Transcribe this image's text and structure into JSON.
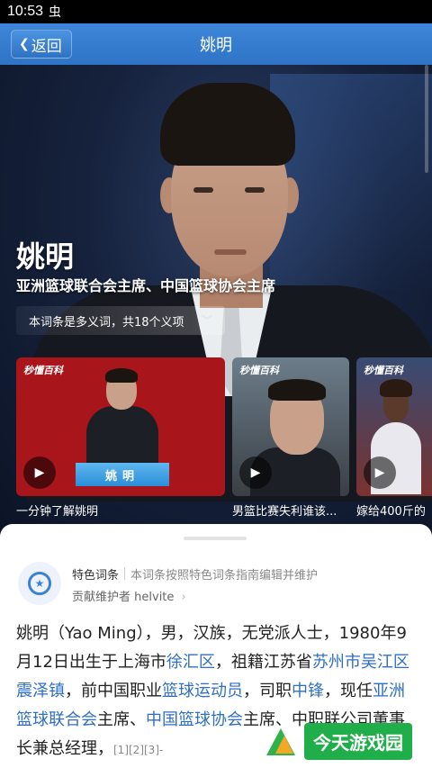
{
  "status_bar": {
    "time": "10:53",
    "bug_icon": "虫"
  },
  "nav": {
    "back_label": "返回",
    "title": "姚明"
  },
  "hero": {
    "name": "姚明",
    "subtitle": "亚洲篮球联合会主席、中国篮球协会主席",
    "polysemy_label": "本词条是多义词，共18个义项"
  },
  "videos": [
    {
      "logo": "秒懂百科",
      "ribbon": "姚明",
      "caption": "一分钟了解姚明"
    },
    {
      "logo": "秒懂百科",
      "caption": "男篮比赛失利谁该..."
    },
    {
      "logo": "秒懂百科",
      "caption": "嫁给400斤的"
    }
  ],
  "feature": {
    "label": "特色词条",
    "desc": "本词条按照特色词条指南编辑并维护",
    "contributor_prefix": "贡献维护者",
    "contributor_name": "helvite"
  },
  "body": {
    "t1": "姚明（Yao Ming），男，汉族，无党派人士，1980年9月12日出生于上海市",
    "l1": "徐汇区",
    "t2": "，祖籍江苏省",
    "l2": "苏州市吴江区震泽镇",
    "t3": "，前中国职业",
    "l3": "篮球运动员",
    "t4": "，司职",
    "l4": "中锋",
    "t5": "，现任",
    "l5": "亚洲篮球联合会",
    "t6": "主席、",
    "l6": "中国篮球协会",
    "t7": "主席、中职联公司董事长兼总经理，",
    "refs": "[1][2][3]-"
  },
  "watermark": {
    "text": "今天游戏园"
  },
  "colors": {
    "nav_bg": "#3a7fd0",
    "link": "#2e6fc4",
    "card1_bg": "#a8161b",
    "watermark_bg": "#1fae4a"
  }
}
